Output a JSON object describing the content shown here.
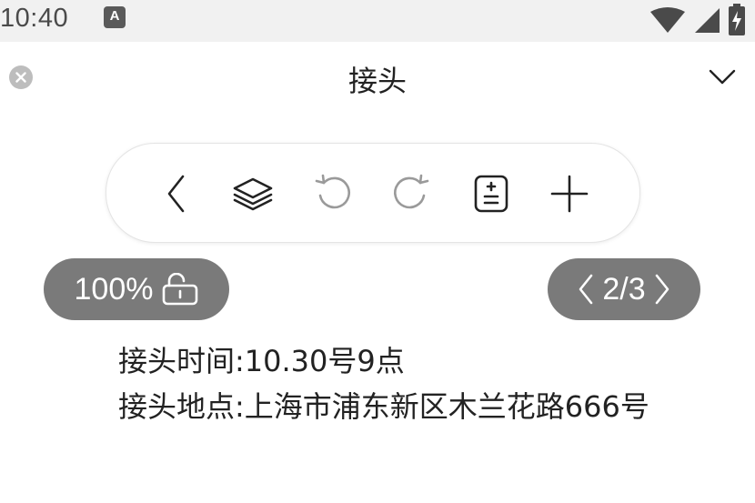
{
  "status_bar": {
    "time": "10:40",
    "notification_icon_letter": "A"
  },
  "header": {
    "title": "接头"
  },
  "toolbar": {
    "icons": [
      "back-icon",
      "layers-icon",
      "undo-icon",
      "redo-icon",
      "note-adjust-icon",
      "add-icon"
    ]
  },
  "zoom": {
    "label": "100%"
  },
  "pagination": {
    "label": "2/3",
    "current": 2,
    "total": 3
  },
  "note": {
    "lines": [
      "接头时间:10.30号9点",
      "接头地点:上海市浦东新区木兰花路666号"
    ]
  },
  "colors": {
    "status_bar_bg": "#f1f1f1",
    "pill_bg": "#7a7a7a",
    "text": "#222222"
  }
}
